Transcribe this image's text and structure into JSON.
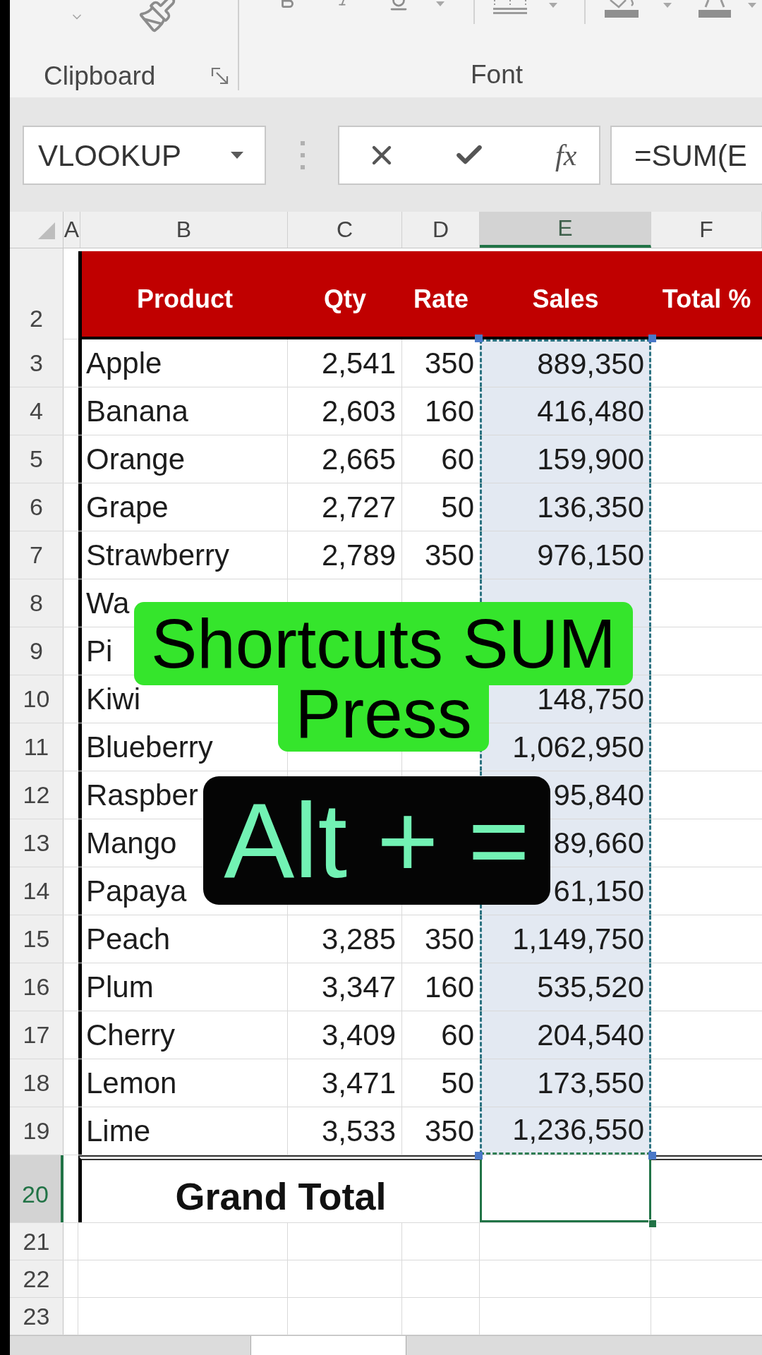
{
  "ribbon": {
    "groups": [
      {
        "label": "Clipboard",
        "dialog_launcher": true
      },
      {
        "label": "Font"
      }
    ]
  },
  "name_box": {
    "value": "VLOOKUP"
  },
  "formula_bar": {
    "function_label": "fx",
    "value": "=SUM(E"
  },
  "columns": [
    {
      "label": "A",
      "selected": false
    },
    {
      "label": "B",
      "selected": false
    },
    {
      "label": "C",
      "selected": false
    },
    {
      "label": "D",
      "selected": false
    },
    {
      "label": "E",
      "selected": true
    },
    {
      "label": "F",
      "selected": false
    }
  ],
  "header_row": {
    "number": "2",
    "selected": false,
    "cells": [
      "Product",
      "Qty",
      "Rate",
      "Sales",
      "Total %"
    ]
  },
  "data_rows": [
    {
      "number": "3",
      "selected": false,
      "in_range": true,
      "product": "Apple",
      "qty": "2,541",
      "rate": "350",
      "sales": "889,350"
    },
    {
      "number": "4",
      "selected": false,
      "in_range": true,
      "product": "Banana",
      "qty": "2,603",
      "rate": "160",
      "sales": "416,480"
    },
    {
      "number": "5",
      "selected": false,
      "in_range": true,
      "product": "Orange",
      "qty": "2,665",
      "rate": "60",
      "sales": "159,900"
    },
    {
      "number": "6",
      "selected": false,
      "in_range": true,
      "product": "Grape",
      "qty": "2,727",
      "rate": "50",
      "sales": "136,350"
    },
    {
      "number": "7",
      "selected": false,
      "in_range": true,
      "product": "Strawberry",
      "qty": "2,789",
      "rate": "350",
      "sales": "976,150"
    },
    {
      "number": "8",
      "selected": false,
      "in_range": true,
      "product": "Wa"
    },
    {
      "number": "9",
      "selected": false,
      "in_range": true,
      "product": "Pi"
    },
    {
      "number": "10",
      "selected": false,
      "in_range": true,
      "product": "Kiwi",
      "sales": "148,750"
    },
    {
      "number": "11",
      "selected": false,
      "in_range": true,
      "product": "Blueberry",
      "sales": "1,062,950"
    },
    {
      "number": "12",
      "selected": false,
      "in_range": true,
      "product": "Raspber",
      "sales": "95,840"
    },
    {
      "number": "13",
      "selected": false,
      "in_range": true,
      "product": "Mango",
      "sales": "89,660"
    },
    {
      "number": "14",
      "selected": false,
      "in_range": true,
      "product": "Papaya",
      "sales": "61,150"
    },
    {
      "number": "15",
      "selected": false,
      "in_range": true,
      "product": "Peach",
      "qty": "3,285",
      "rate": "350",
      "sales": "1,149,750"
    },
    {
      "number": "16",
      "selected": false,
      "in_range": true,
      "product": "Plum",
      "qty": "3,347",
      "rate": "160",
      "sales": "535,520"
    },
    {
      "number": "17",
      "selected": false,
      "in_range": true,
      "product": "Cherry",
      "qty": "3,409",
      "rate": "60",
      "sales": "204,540"
    },
    {
      "number": "18",
      "selected": false,
      "in_range": true,
      "product": "Lemon",
      "qty": "3,471",
      "rate": "50",
      "sales": "173,550"
    },
    {
      "number": "19",
      "selected": false,
      "in_range": true,
      "product": "Lime",
      "qty": "3,533",
      "rate": "350",
      "sales": "1,236,550"
    }
  ],
  "total_row": {
    "number": "20",
    "selected": true,
    "label": "Grand Total",
    "active_cell": true
  },
  "empty_rows": [
    {
      "number": "21",
      "selected": false
    },
    {
      "number": "22",
      "selected": false
    },
    {
      "number": "23",
      "selected": false
    }
  ],
  "captions": [
    {
      "kind": "highlight",
      "lines": [
        "Shortcuts SUM",
        "Press"
      ]
    },
    {
      "kind": "keys",
      "lines": [
        "Alt + ="
      ]
    }
  ]
}
